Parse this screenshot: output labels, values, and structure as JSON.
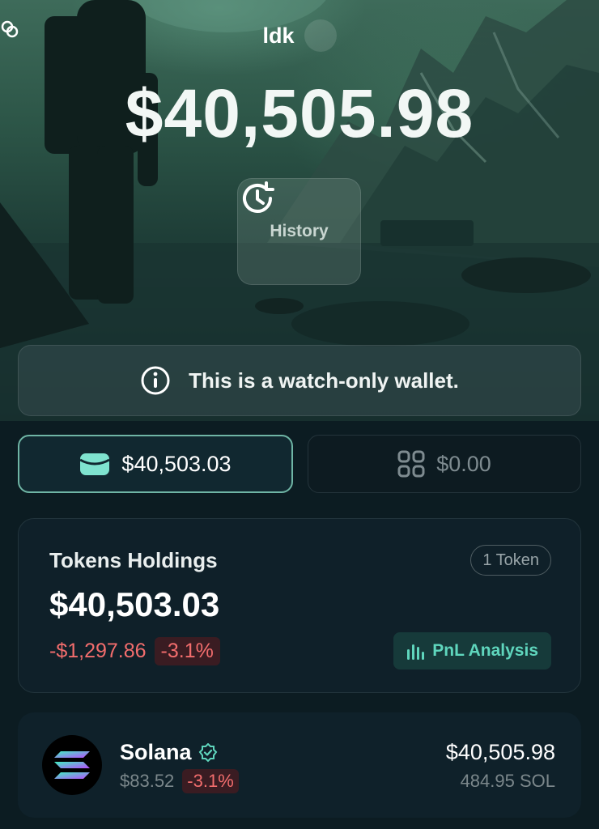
{
  "wallet": {
    "name": "ldk",
    "balance": "$40,505.98",
    "history_label": "History"
  },
  "banner": {
    "text": "This is a watch-only wallet."
  },
  "tabs": [
    {
      "value": "$40,503.03",
      "icon": "wallet-icon",
      "active": true
    },
    {
      "value": "$0.00",
      "icon": "grid-icon",
      "active": false
    }
  ],
  "holdings": {
    "title": "Tokens Holdings",
    "token_count": "1 Token",
    "value": "$40,503.03",
    "change_amount": "-$1,297.86",
    "change_percent": "-3.1%",
    "pnl_label": "PnL Analysis"
  },
  "tokens": [
    {
      "name": "Solana",
      "verified": true,
      "price": "$83.52",
      "change_percent": "-3.1%",
      "value": "$40,505.98",
      "amount": "484.95 SOL"
    }
  ],
  "colors": {
    "accent": "#5fd6bd",
    "negative": "#f26d6d",
    "background": "#0c1c22"
  }
}
